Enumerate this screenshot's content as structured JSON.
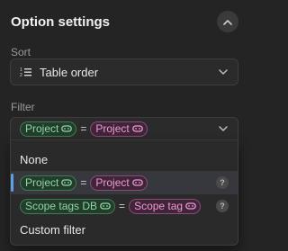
{
  "header": {
    "title": "Option settings"
  },
  "sort": {
    "label": "Sort",
    "value": "Table order",
    "icon": "sort-list-icon"
  },
  "filter": {
    "label": "Filter",
    "current": {
      "left": "Project",
      "op": "=",
      "right": "Project"
    },
    "options": [
      {
        "kind": "text",
        "label": "None"
      },
      {
        "kind": "expr",
        "left": "Project",
        "op": "=",
        "right": "Project",
        "help": "?",
        "selected": true
      },
      {
        "kind": "expr",
        "left": "Scope tags DB",
        "op": "=",
        "right": "Scope tag",
        "help": "?"
      },
      {
        "kind": "text",
        "label": "Custom filter"
      }
    ]
  },
  "colors": {
    "background": "#242424",
    "green_pill": "#8fd6a3",
    "pink_pill": "#ee9ad9",
    "selection_bar": "#5ea0e8"
  }
}
